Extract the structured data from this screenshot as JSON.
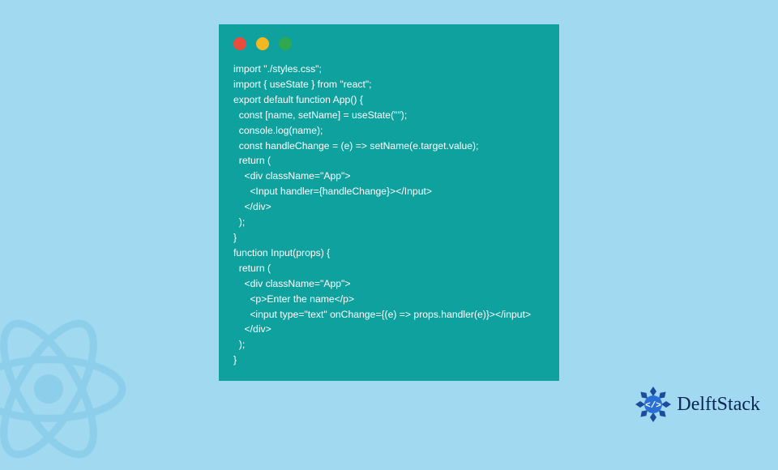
{
  "window": {
    "dots": {
      "red": "#e94b3c",
      "yellow": "#f3b821",
      "green": "#2fa84f"
    }
  },
  "code": {
    "lines": [
      "import \"./styles.css\";",
      "import { useState } from \"react\";",
      "export default function App() {",
      "  const [name, setName] = useState(\"\");",
      "  console.log(name);",
      "  const handleChange = (e) => setName(e.target.value);",
      "  return (",
      "    <div className=\"App\">",
      "      <Input handler={handleChange}></Input>",
      "    </div>",
      "  );",
      "}",
      "function Input(props) {",
      "  return (",
      "    <div className=\"App\">",
      "      <p>Enter the name</p>",
      "      <input type=\"text\" onChange={(e) => props.handler(e)}></input>",
      "    </div>",
      "  );",
      "}"
    ]
  },
  "brand": {
    "name": "DelftStack"
  }
}
